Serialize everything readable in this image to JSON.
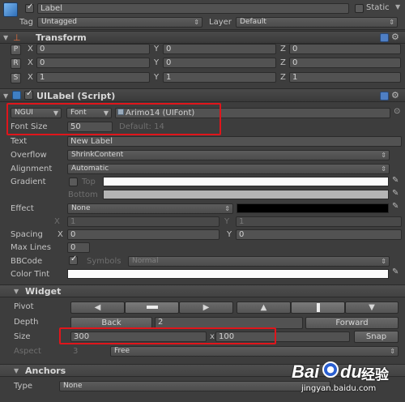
{
  "gameobject": {
    "name": "Label",
    "static_label": "Static",
    "tag_label": "Tag",
    "tag_value": "Untagged",
    "layer_label": "Layer",
    "layer_value": "Default"
  },
  "transform": {
    "title": "Transform",
    "rows": [
      {
        "btn": "P",
        "x": "0",
        "y": "0",
        "z": "0"
      },
      {
        "btn": "R",
        "x": "0",
        "y": "0",
        "z": "0"
      },
      {
        "btn": "S",
        "x": "1",
        "y": "1",
        "z": "1"
      }
    ],
    "axis": {
      "x": "X",
      "y": "Y",
      "z": "Z"
    }
  },
  "uilabel": {
    "title": "UILabel (Script)",
    "font_type": "NGUI",
    "font_btn": "Font",
    "font_asset": "Arimo14 (UIFont)",
    "font_size_label": "Font Size",
    "font_size_value": "50",
    "font_size_default": "Default: 14",
    "text_label": "Text",
    "text_value": "New Label",
    "overflow_label": "Overflow",
    "overflow_value": "ShrinkContent",
    "alignment_label": "Alignment",
    "alignment_value": "Automatic",
    "gradient_label": "Gradient",
    "top_label": "Top",
    "bottom_label": "Bottom",
    "effect_label": "Effect",
    "effect_value": "None",
    "effect_x_label": "X",
    "effect_x_value": "1",
    "effect_y_label": "Y",
    "effect_y_value": "1",
    "spacing_label": "Spacing",
    "spacing_x_label": "X",
    "spacing_x_value": "0",
    "spacing_y_label": "Y",
    "spacing_y_value": "0",
    "maxlines_label": "Max Lines",
    "maxlines_value": "0",
    "bbcode_label": "BBCode",
    "symbols_label": "Symbols",
    "symbols_value": "Normal",
    "colortint_label": "Color Tint"
  },
  "widget": {
    "title": "Widget",
    "pivot_label": "Pivot",
    "depth_label": "Depth",
    "back_label": "Back",
    "depth_value": "2",
    "forward_label": "Forward",
    "size_label": "Size",
    "size_w": "300",
    "size_x": "x",
    "size_h": "100",
    "snap_label": "Snap",
    "aspect_label": "Aspect",
    "aspect_value": "3",
    "aspect_mode": "Free"
  },
  "anchors": {
    "title": "Anchors",
    "type_label": "Type",
    "type_value": "None"
  },
  "watermark": {
    "brand": "Bai",
    "brand2": "du",
    "jingyan": "经验",
    "url": "jingyan.baidu.com"
  },
  "colors": {
    "accent_red": "#e0151b",
    "panel": "#3d3d3d",
    "header": "#454545"
  }
}
